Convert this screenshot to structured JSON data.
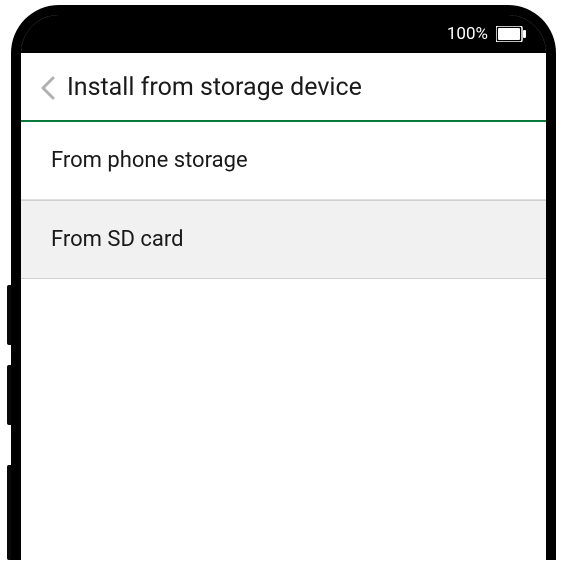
{
  "status_bar": {
    "battery_percentage": "100%"
  },
  "header": {
    "title": "Install from storage device"
  },
  "options": [
    {
      "label": "From phone storage",
      "highlighted": false
    },
    {
      "label": "From SD card",
      "highlighted": true
    }
  ]
}
